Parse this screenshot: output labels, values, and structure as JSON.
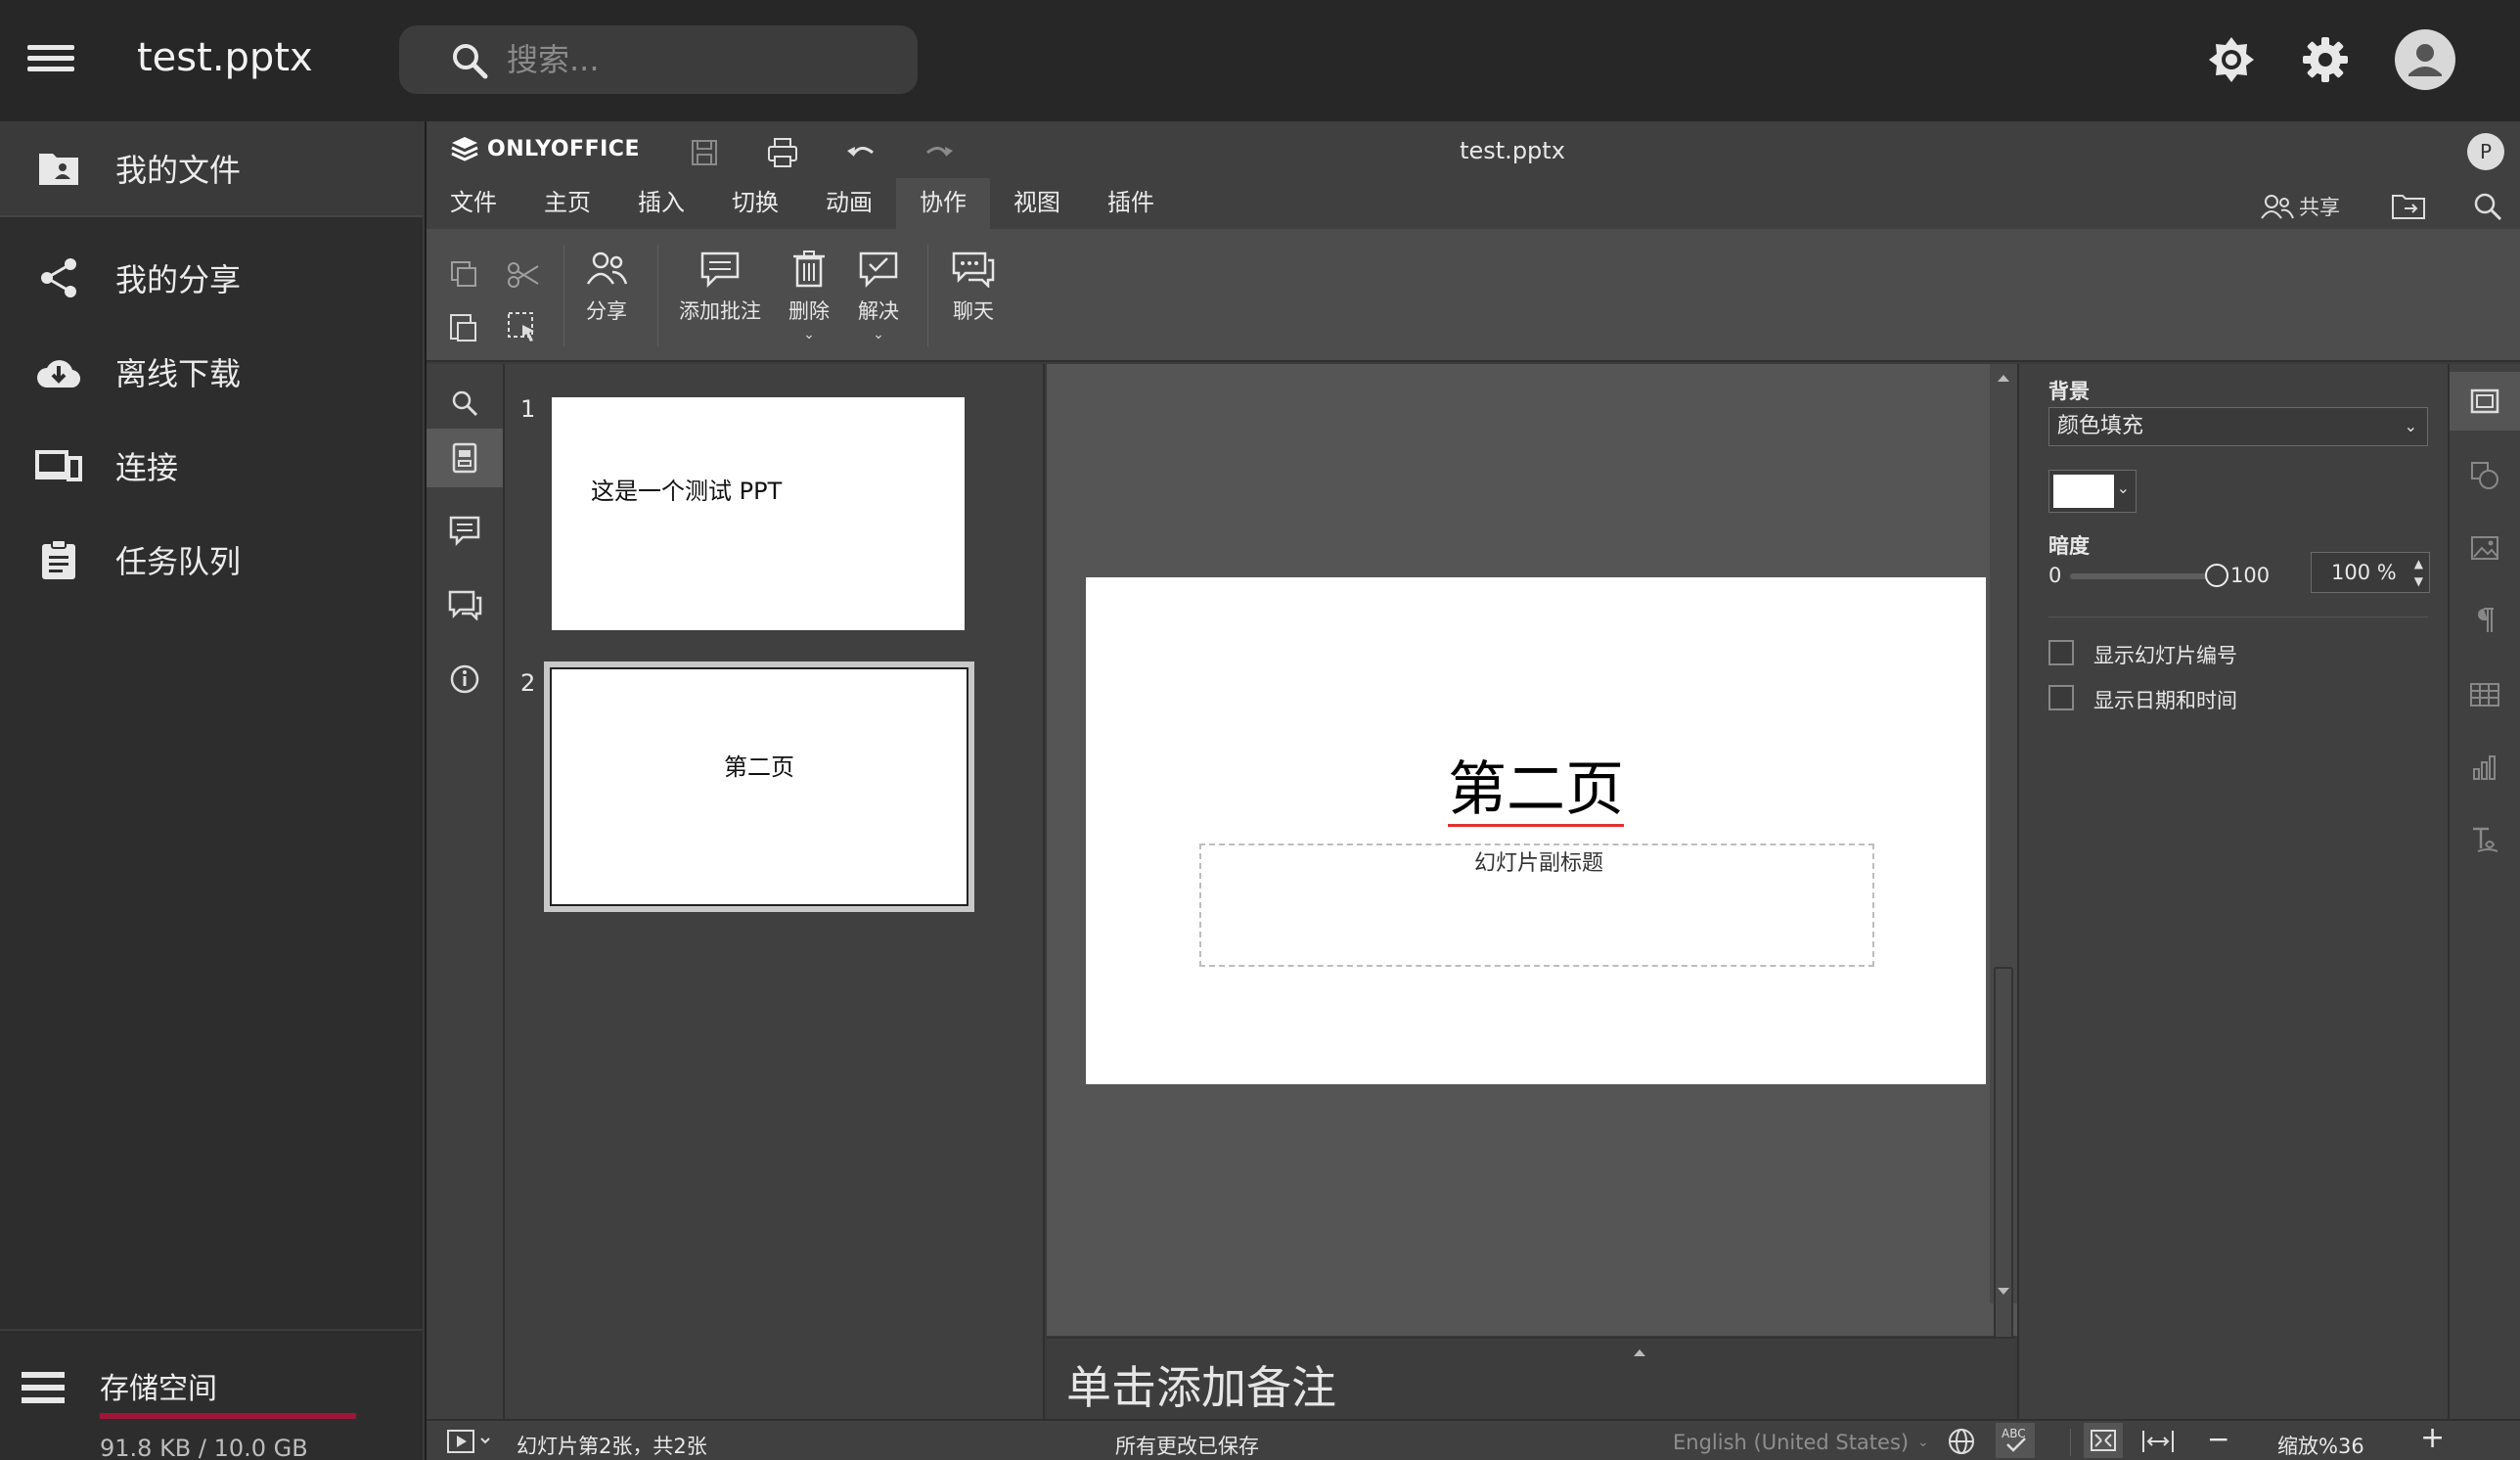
{
  "app": {
    "title": "test.pptx",
    "search_placeholder": "搜索..."
  },
  "nav": {
    "items": [
      {
        "label": "我的文件",
        "icon": "folder-user-icon"
      },
      {
        "label": "我的分享",
        "icon": "share-icon"
      },
      {
        "label": "离线下载",
        "icon": "cloud-download-icon"
      },
      {
        "label": "连接",
        "icon": "devices-icon"
      },
      {
        "label": "任务队列",
        "icon": "clipboard-icon"
      }
    ],
    "storage": {
      "label": "存储空间",
      "usage": "91.8 KB / 10.0 GB",
      "used_fraction": 0.009
    }
  },
  "editor": {
    "brand": "ONLYOFFICE",
    "doc_title": "test.pptx",
    "user_initial": "P",
    "menu_tabs": [
      "文件",
      "主页",
      "插入",
      "切换",
      "动画",
      "协作",
      "视图",
      "插件"
    ],
    "active_tab": "协作",
    "share_label": "共享",
    "ribbon": {
      "share": "分享",
      "add_comment": "添加批注",
      "delete": "删除",
      "resolve": "解决",
      "chat": "聊天"
    },
    "slides": [
      {
        "number": "1",
        "text": "这是一个测试 PPT"
      },
      {
        "number": "2",
        "text": "第二页"
      }
    ],
    "current_slide": {
      "title": "第二页",
      "subtitle_placeholder": "幻灯片副标题"
    },
    "notes_placeholder": "单击添加备注",
    "settings": {
      "background_label": "背景",
      "fill_type": "颜色填充",
      "fill_color": "#ffffff",
      "opacity_label": "暗度",
      "opacity_min": "0",
      "opacity_max": "100",
      "opacity_value": "100 %",
      "opacity_fraction": 1.0,
      "show_slide_number": "显示幻灯片编号",
      "show_date_time": "显示日期和时间"
    },
    "status": {
      "slide_info": "幻灯片第2张，共2张",
      "save_state": "所有更改已保存",
      "language": "English (United States)",
      "zoom": "缩放%36"
    }
  },
  "colors": {
    "accent_storage": "#a0163a"
  }
}
